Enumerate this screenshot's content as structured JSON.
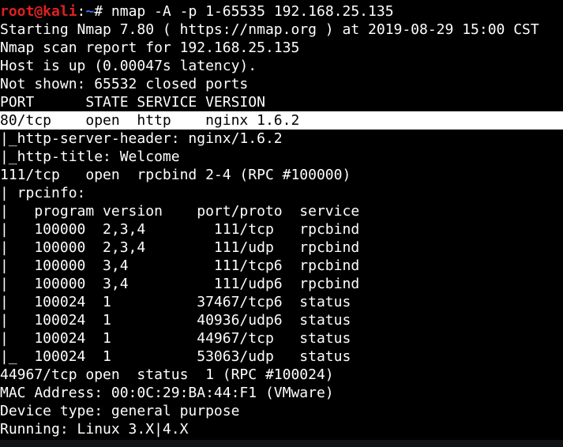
{
  "prompt": {
    "user_host": "root@kali",
    "separator": ":",
    "path": "~",
    "symbol": "#",
    "command": " nmap -A -p 1-65535 192.168.25.135"
  },
  "lines": [
    "Starting Nmap 7.80 ( https://nmap.org ) at 2019-08-29 15:00 CST",
    "Nmap scan report for 192.168.25.135",
    "Host is up (0.00047s latency).",
    "Not shown: 65532 closed ports",
    "PORT      STATE SERVICE VERSION",
    "80/tcp    open  http    nginx 1.6.2",
    "|_http-server-header: nginx/1.6.2",
    "|_http-title: Welcome",
    "111/tcp   open  rpcbind 2-4 (RPC #100000)",
    "| rpcinfo:",
    "|   program version    port/proto  service",
    "|   100000  2,3,4        111/tcp   rpcbind",
    "|   100000  2,3,4        111/udp   rpcbind",
    "|   100000  3,4          111/tcp6  rpcbind",
    "|   100000  3,4          111/udp6  rpcbind",
    "|   100024  1          37467/tcp6  status",
    "|   100024  1          40936/udp6  status",
    "|   100024  1          44967/tcp   status",
    "|_  100024  1          53063/udp   status",
    "44967/tcp open  status  1 (RPC #100024)",
    "MAC Address: 00:0C:29:BA:44:F1 (VMware)",
    "Device type: general purpose",
    "Running: Linux 3.X|4.X"
  ],
  "highlighted_line": "80/tcp    open  http    nginx 1.6.2",
  "colors": {
    "background": "#000000",
    "text": "#ffffff",
    "prompt_user": "#e02020",
    "prompt_path": "#3a6fe0",
    "highlight_bg": "#ffffff",
    "highlight_text": "#000000"
  }
}
